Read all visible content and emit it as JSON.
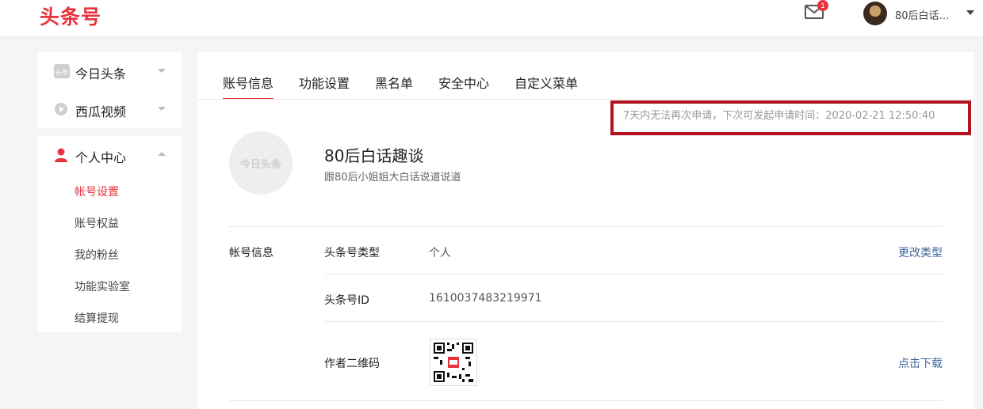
{
  "header": {
    "logo": "头条号",
    "mail_badge": "1",
    "user_name": "80后白话…"
  },
  "sidebar": {
    "group1": [
      {
        "label": "今日头条",
        "icon": "toutiao-icon"
      },
      {
        "label": "西瓜视频",
        "icon": "xigua-icon"
      }
    ],
    "personal": {
      "label": "个人中心",
      "icon": "user-icon",
      "items": [
        {
          "label": "帐号设置",
          "active": true
        },
        {
          "label": "账号权益"
        },
        {
          "label": "我的粉丝"
        },
        {
          "label": "功能实验室"
        },
        {
          "label": "结算提现"
        }
      ]
    }
  },
  "tabs": [
    "账号信息",
    "功能设置",
    "黑名单",
    "安全中心",
    "自定义菜单"
  ],
  "notice": "7天内无法再次申请，下次可发起申请时间：2020-02-21 12:50:40",
  "profile": {
    "avatar_text": "今日头条",
    "name": "80后白话趣谈",
    "description": "跟80后小姐姐大白话说道说道"
  },
  "account_info": {
    "section_label": "帐号信息",
    "rows": [
      {
        "label": "头条号类型",
        "value": "个人",
        "action": "更改类型"
      },
      {
        "label": "头条号ID",
        "value": "1610037483219971"
      },
      {
        "label": "作者二维码",
        "action": "点击下载"
      }
    ]
  },
  "colors": {
    "brand": "#e8323c",
    "link": "#406599",
    "highlight": "#b0131d"
  }
}
